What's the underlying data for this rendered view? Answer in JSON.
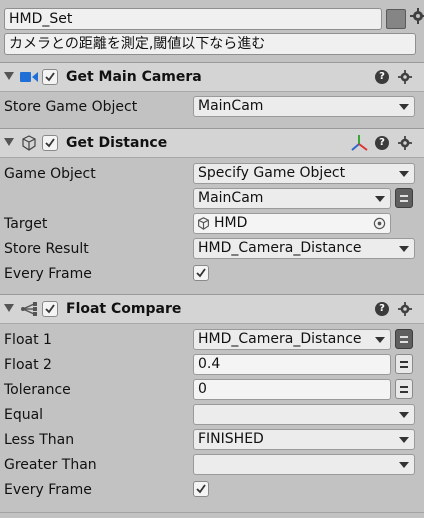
{
  "state": {
    "name": "HMD_Set",
    "description": "カメラとの距離を測定,閾値以下なら進む"
  },
  "sections": {
    "get_main_camera": {
      "title": "Get Main Camera",
      "fields": {
        "store_game_object": {
          "label": "Store Game Object",
          "value": "MainCam"
        }
      }
    },
    "get_distance": {
      "title": "Get Distance",
      "fields": {
        "game_object": {
          "label": "Game Object",
          "value": "Specify Game Object",
          "sub_value": "MainCam"
        },
        "target": {
          "label": "Target",
          "value": "HMD"
        },
        "store_result": {
          "label": "Store Result",
          "value": "HMD_Camera_Distance"
        },
        "every_frame": {
          "label": "Every Frame",
          "checked": true
        }
      }
    },
    "float_compare": {
      "title": "Float Compare",
      "fields": {
        "float1": {
          "label": "Float 1",
          "value": "HMD_Camera_Distance"
        },
        "float2": {
          "label": "Float 2",
          "value": "0.4"
        },
        "tolerance": {
          "label": "Tolerance",
          "value": "0"
        },
        "equal": {
          "label": "Equal",
          "value": ""
        },
        "less_than": {
          "label": "Less Than",
          "value": "FINISHED"
        },
        "greater_than": {
          "label": "Greater Than",
          "value": ""
        },
        "every_frame": {
          "label": "Every Frame",
          "checked": true
        }
      }
    }
  },
  "icons": {
    "help": "help-icon",
    "settings": "gear-icon",
    "camera": "camera-icon",
    "cube": "cube-icon",
    "transform_axes": "transform-axes-icon",
    "compare": "compare-icon",
    "target_picker": "target-picker-icon"
  },
  "colors": {
    "camera_icon": "#1f6fd6",
    "axis_x": "#d33",
    "axis_y": "#3a3",
    "axis_z": "#36c"
  },
  "help_glyph": "?"
}
